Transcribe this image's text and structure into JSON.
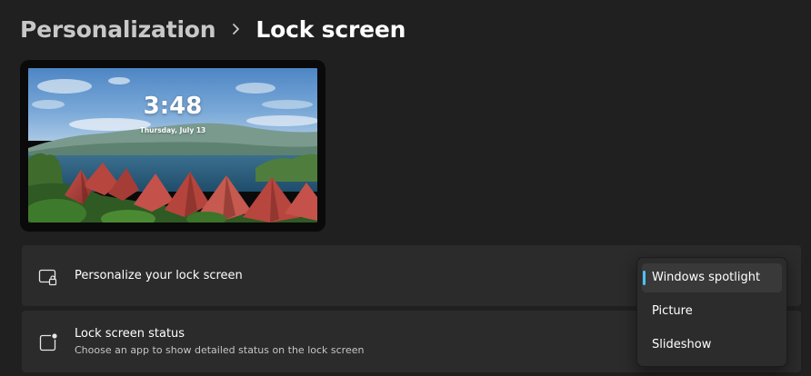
{
  "breadcrumb": {
    "parent": "Personalization",
    "current": "Lock screen"
  },
  "preview": {
    "time": "3:48",
    "date": "Thursday, July 13"
  },
  "settings": {
    "personalize": {
      "title": "Personalize your lock screen",
      "icon": "lock-screen-icon"
    },
    "status": {
      "title": "Lock screen status",
      "description": "Choose an app to show detailed status on the lock screen",
      "icon": "status-icon"
    }
  },
  "dropdown": {
    "options": [
      "Windows spotlight",
      "Picture",
      "Slideshow"
    ],
    "selected": "Windows spotlight",
    "accent": "#4cc2ff"
  },
  "colors": {
    "background": "#202020",
    "card": "#2b2b2b",
    "accent": "#4cc2ff"
  }
}
